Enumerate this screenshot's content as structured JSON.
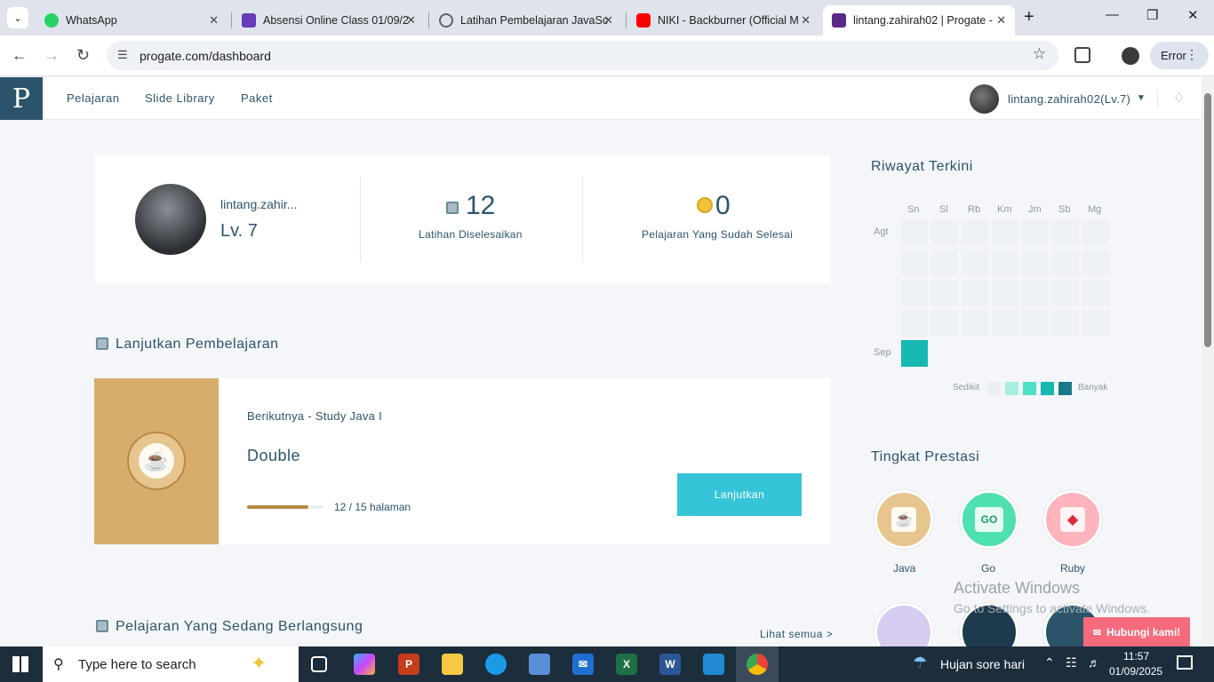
{
  "browser": {
    "tabs": [
      {
        "title": "WhatsApp",
        "color": "#25d366"
      },
      {
        "title": "Absensi Online Class 01/09/2",
        "color": "#673ab7"
      },
      {
        "title": "Latihan Pembelajaran JavaSc",
        "color": "#5f6368"
      },
      {
        "title": "NIKI - Backburner (Official M",
        "color": "#ff0000"
      },
      {
        "title": "lintang.zahirah02 | Progate -",
        "color": "#5b2a86"
      }
    ],
    "url": "progate.com/dashboard",
    "error_label": "Error"
  },
  "header": {
    "logo": "P",
    "nav": [
      "Pelajaran",
      "Slide Library",
      "Paket"
    ],
    "user": "lintang.zahirah02(Lv.7)"
  },
  "profile": {
    "name": "lintang.zahir...",
    "level": "Lv. 7",
    "exercises_count": "12",
    "exercises_label": "Latihan Diselesaikan",
    "lessons_count": "0",
    "lessons_label": "Pelajaran Yang Sudah Selesai"
  },
  "continue": {
    "section_title": "Lanjutkan Pembelajaran",
    "next_label": "Berikutnya - Study Java I",
    "lesson_title": "Double",
    "progress_text": "12 / 15 halaman",
    "progress": 0.8,
    "button": "Lanjutkan"
  },
  "ongoing": {
    "section_title": "Pelajaran Yang Sedang Berlangsung",
    "see_all": "Lihat semua >"
  },
  "history": {
    "title": "Riwayat Terkini",
    "days": [
      "Sn",
      "Sl",
      "Rb",
      "Km",
      "Jm",
      "Sb",
      "Mg"
    ],
    "months": [
      "Agt",
      "Sep"
    ],
    "legend_low": "Sedikit",
    "legend_high": "Banyak",
    "legend_colors": [
      "#e9eef3",
      "#a8ede0",
      "#4ee0c8",
      "#16b8b0",
      "#1a7a86"
    ]
  },
  "achievements": {
    "title": "Tingkat Prestasi",
    "items": [
      "Java",
      "Go",
      "Ruby"
    ]
  },
  "contact_button": "Hubungi kami!",
  "watermark": {
    "line1": "Activate Windows",
    "line2": "Go to Settings to activate Windows."
  },
  "taskbar": {
    "search_placeholder": "Type here to search",
    "weather": "Hujan sore hari",
    "time": "11:57",
    "date": "01/09/2025"
  }
}
